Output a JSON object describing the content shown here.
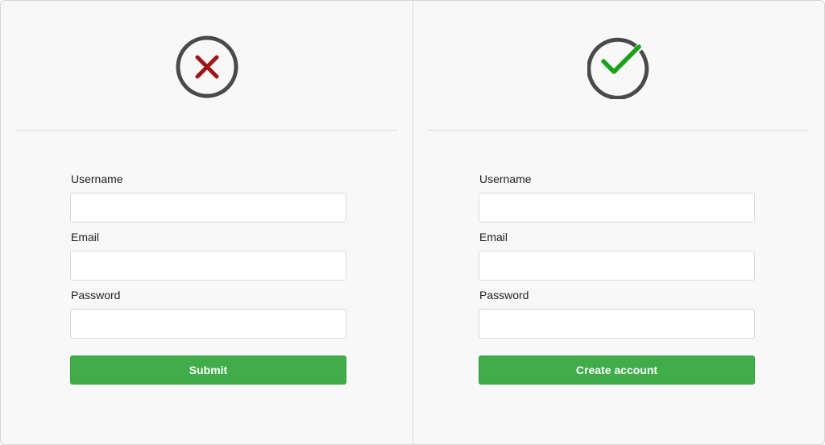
{
  "colors": {
    "background": "#f8f8f8",
    "button_green": "#40ac4a",
    "error_red": "#a01515",
    "success_green": "#1aa21a",
    "icon_ring": "#4a4a4a"
  },
  "left_panel": {
    "status_icon": "x-circle-icon",
    "fields": [
      {
        "label": "Username",
        "value": "",
        "placeholder": ""
      },
      {
        "label": "Email",
        "value": "",
        "placeholder": ""
      },
      {
        "label": "Password",
        "value": "",
        "placeholder": ""
      }
    ],
    "button_label": "Submit"
  },
  "right_panel": {
    "status_icon": "check-circle-icon",
    "fields": [
      {
        "label": "Username",
        "value": "",
        "placeholder": ""
      },
      {
        "label": "Email",
        "value": "",
        "placeholder": ""
      },
      {
        "label": "Password",
        "value": "",
        "placeholder": ""
      }
    ],
    "button_label": "Create account"
  }
}
